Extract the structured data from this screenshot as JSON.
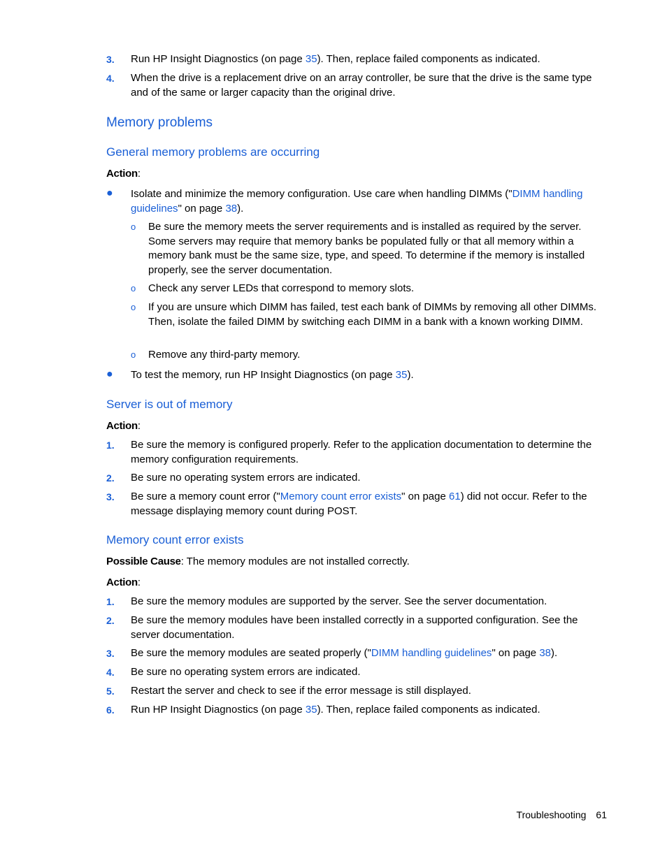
{
  "top_list": [
    {
      "num": "3.",
      "pre": "Run HP Insight Diagnostics (on page ",
      "link": "35",
      "post": "). Then, replace failed components as indicated."
    },
    {
      "num": "4.",
      "text": "When the drive is a replacement drive on an array controller, be sure that the drive is the same type and of the same or larger capacity than the original drive."
    }
  ],
  "section_title": "Memory problems",
  "general": {
    "title": "General memory problems are occurring",
    "action_label": "Action",
    "bullet1": {
      "pre": "Isolate and minimize the memory configuration. Use care when handling DIMMs (\"",
      "link": "DIMM handling guidelines",
      "mid": "\" on page ",
      "page": "38",
      "post": ")."
    },
    "sub_items": [
      "Be sure the memory meets the server requirements and is installed as required by the server. Some servers may require that memory banks be populated fully or that all memory within a memory bank must be the same size, type, and speed. To determine if the memory is installed properly, see the server documentation.",
      "Check any server LEDs that correspond to memory slots.",
      "If you are unsure which DIMM has failed, test each bank of DIMMs by removing all other DIMMs. Then, isolate the failed DIMM by switching each DIMM in a bank with a known working DIMM.",
      "Remove any third-party memory."
    ],
    "bullet2": {
      "pre": "To test the memory, run HP Insight Diagnostics (on page ",
      "link": "35",
      "post": ")."
    }
  },
  "out_of_memory": {
    "title": "Server is out of memory",
    "action_label": "Action",
    "items": [
      {
        "num": "1.",
        "text": "Be sure the memory is configured properly. Refer to the application documentation to determine the memory configuration requirements."
      },
      {
        "num": "2.",
        "text": "Be sure no operating system errors are indicated."
      },
      {
        "num": "3.",
        "pre": "Be sure a memory count error (\"",
        "link": "Memory count error exists",
        "mid": "\" on page ",
        "page": "61",
        "post": ") did not occur. Refer to the message displaying memory count during POST."
      }
    ]
  },
  "count_error": {
    "title": "Memory count error exists",
    "cause_label": "Possible Cause",
    "cause_text": ": The memory modules are not installed correctly.",
    "action_label": "Action",
    "items": [
      {
        "num": "1.",
        "text": "Be sure the memory modules are supported by the server. See the server documentation."
      },
      {
        "num": "2.",
        "text": "Be sure the memory modules have been installed correctly in a supported configuration. See the server documentation."
      },
      {
        "num": "3.",
        "pre": "Be sure the memory modules are seated properly (\"",
        "link": "DIMM handling guidelines",
        "mid": "\" on page ",
        "page": "38",
        "post": ")."
      },
      {
        "num": "4.",
        "text": "Be sure no operating system errors are indicated."
      },
      {
        "num": "5.",
        "text": "Restart the server and check to see if the error message is still displayed."
      },
      {
        "num": "6.",
        "pre": "Run HP Insight Diagnostics (on page ",
        "link": "35",
        "post": "). Then, replace failed components as indicated."
      }
    ]
  },
  "footer": {
    "section": "Troubleshooting",
    "page": "61"
  }
}
